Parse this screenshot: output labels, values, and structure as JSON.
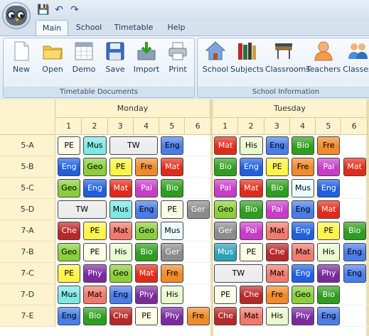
{
  "ribbon": {
    "tabs": [
      "Main",
      "School",
      "Timetable",
      "Help"
    ],
    "groups": {
      "documents": {
        "label": "Timetable Documents",
        "buttons": [
          "New",
          "Open",
          "Demo",
          "Save",
          "Import",
          "Print"
        ]
      },
      "school": {
        "label": "School Information",
        "buttons": [
          "School",
          "Subjects",
          "Classrooms",
          "Teachers",
          "Classes"
        ]
      }
    }
  },
  "timetable": {
    "days": [
      "Monday",
      "Tuesday"
    ],
    "periods": [
      "1",
      "2",
      "3",
      "4",
      "5",
      "6"
    ],
    "colors": {
      "PE": "#fdfdd8",
      "Mus": "#7be3e6",
      "TW": "#ececec",
      "Eng": "#1f5fe0",
      "Geo": "#8ccf3c",
      "Fre": "#f08a2a",
      "Mat": "#e02020",
      "Bio": "#2e9e1e",
      "Pai": "#c83cc8",
      "Ger": "#808080",
      "Che": "#b82828",
      "His": "#e6f7c2",
      "Phy": "#7a2a9e",
      "Mus7": "#2aa2b8",
      "MatLight": "#f07a6e",
      "MusLight": "#e9fdff",
      "PeTue": "#fdfdd8"
    },
    "rows": [
      {
        "label": "5-A",
        "mon": [
          {
            "s": "PE",
            "p": 1,
            "c": "#fdfde6"
          },
          {
            "s": "Mus",
            "p": 2,
            "c": "#7ee8e6"
          },
          {
            "s": "TW",
            "p": 3,
            "span": 2,
            "c": "#ececec"
          },
          {
            "s": "Eng",
            "p": 5,
            "c": "#4a7de8"
          }
        ],
        "tue": [
          {
            "s": "Mat",
            "p": 1,
            "c": "#e22a1a"
          },
          {
            "s": "His",
            "p": 2,
            "c": "#eafad0"
          },
          {
            "s": "Eng",
            "p": 3,
            "c": "#4a7de8"
          },
          {
            "s": "Bio",
            "p": 4,
            "c": "#2e9e1e"
          },
          {
            "s": "Fre",
            "p": 5,
            "c": "#f08a2a"
          }
        ]
      },
      {
        "label": "5-B",
        "mon": [
          {
            "s": "Eng",
            "p": 1,
            "c": "#1f5fe0"
          },
          {
            "s": "Geo",
            "p": 2,
            "c": "#8ccf3c"
          },
          {
            "s": "PE",
            "p": 3,
            "c": "#fff44a"
          },
          {
            "s": "Fre",
            "p": 4,
            "c": "#f08a2a"
          },
          {
            "s": "Mat",
            "p": 5,
            "c": "#e22a1a"
          }
        ],
        "tue": [
          {
            "s": "Bio",
            "p": 1,
            "c": "#2e9e1e"
          },
          {
            "s": "Eng",
            "p": 2,
            "c": "#1f5fe0"
          },
          {
            "s": "PE",
            "p": 3,
            "c": "#fff44a"
          },
          {
            "s": "Fre",
            "p": 4,
            "c": "#f08a2a"
          },
          {
            "s": "Pai",
            "p": 5,
            "c": "#c83cc8"
          },
          {
            "s": "Mat",
            "p": 6,
            "c": "#e22a1a"
          }
        ]
      },
      {
        "label": "5-C",
        "mon": [
          {
            "s": "Geo",
            "p": 1,
            "c": "#8ccf3c"
          },
          {
            "s": "Eng",
            "p": 2,
            "c": "#1f5fe0"
          },
          {
            "s": "Mat",
            "p": 3,
            "c": "#e22a1a"
          },
          {
            "s": "Pai",
            "p": 4,
            "c": "#c83cc8"
          },
          {
            "s": "Bio",
            "p": 5,
            "c": "#2e9e1e"
          }
        ],
        "tue": [
          {
            "s": "Pai",
            "p": 1,
            "c": "#c83cc8"
          },
          {
            "s": "Mat",
            "p": 2,
            "c": "#e22a1a"
          },
          {
            "s": "Bio",
            "p": 3,
            "c": "#2e9e1e"
          },
          {
            "s": "Mus",
            "p": 4,
            "c": "#e9fdff"
          },
          {
            "s": "Eng",
            "p": 5,
            "c": "#1f5fe0"
          }
        ]
      },
      {
        "label": "5-D",
        "mon": [
          {
            "s": "TW",
            "p": 1,
            "span": 2,
            "c": "#ececec"
          },
          {
            "s": "Mus",
            "p": 3,
            "c": "#7ee8e6"
          },
          {
            "s": "Eng",
            "p": 4,
            "c": "#4a7de8"
          },
          {
            "s": "PE",
            "p": 5,
            "c": "#fdfde6"
          },
          {
            "s": "Ger",
            "p": 6,
            "c": "#8c8c8c"
          }
        ],
        "tue": [
          {
            "s": "Geo",
            "p": 1,
            "c": "#8ccf3c"
          },
          {
            "s": "Bio",
            "p": 2,
            "c": "#2e9e1e"
          },
          {
            "s": "Pai",
            "p": 3,
            "c": "#c83cc8"
          },
          {
            "s": "Eng",
            "p": 4,
            "c": "#4a7de8"
          },
          {
            "s": "Mat",
            "p": 5,
            "c": "#e22a1a"
          }
        ]
      },
      {
        "label": "7-A",
        "mon": [
          {
            "s": "Che",
            "p": 1,
            "c": "#b82828"
          },
          {
            "s": "PE",
            "p": 2,
            "c": "#fff44a"
          },
          {
            "s": "Mat",
            "p": 3,
            "c": "#f07a6e"
          },
          {
            "s": "Geo",
            "p": 4,
            "c": "#8ccf3c"
          },
          {
            "s": "Mus",
            "p": 5,
            "c": "#e9fdff"
          }
        ],
        "tue": [
          {
            "s": "Ger",
            "p": 1,
            "c": "#8c8c8c"
          },
          {
            "s": "Pai",
            "p": 2,
            "c": "#c83cc8"
          },
          {
            "s": "Mat",
            "p": 3,
            "c": "#f07a6e"
          },
          {
            "s": "Eng",
            "p": 4,
            "c": "#1f5fe0"
          },
          {
            "s": "PE",
            "p": 5,
            "c": "#fff44a"
          },
          {
            "s": "Bio",
            "p": 6,
            "c": "#2e9e1e"
          }
        ]
      },
      {
        "label": "7-B",
        "mon": [
          {
            "s": "Geo",
            "p": 1,
            "c": "#8ccf3c"
          },
          {
            "s": "PE",
            "p": 2,
            "c": "#fdfde6"
          },
          {
            "s": "His",
            "p": 3,
            "c": "#eafad0"
          },
          {
            "s": "Bio",
            "p": 4,
            "c": "#2e9e1e"
          },
          {
            "s": "Ger",
            "p": 5,
            "c": "#8c8c8c"
          }
        ],
        "tue": [
          {
            "s": "Mus",
            "p": 1,
            "c": "#2aa2b8"
          },
          {
            "s": "PE",
            "p": 2,
            "c": "#fdfde6"
          },
          {
            "s": "Che",
            "p": 3,
            "c": "#b82828"
          },
          {
            "s": "Mat",
            "p": 4,
            "c": "#f07a6e"
          },
          {
            "s": "His",
            "p": 5,
            "c": "#eafad0"
          },
          {
            "s": "Eng",
            "p": 6,
            "c": "#4a7de8"
          }
        ]
      },
      {
        "label": "7-C",
        "mon": [
          {
            "s": "PE",
            "p": 1,
            "c": "#fff44a"
          },
          {
            "s": "Phy",
            "p": 2,
            "c": "#7a2a9e"
          },
          {
            "s": "Geo",
            "p": 3,
            "c": "#8ccf3c"
          },
          {
            "s": "Mat",
            "p": 4,
            "c": "#e22a1a"
          },
          {
            "s": "Fre",
            "p": 5,
            "c": "#f08a2a"
          }
        ],
        "tue": [
          {
            "s": "TW",
            "p": 1,
            "span": 2,
            "c": "#ececec"
          },
          {
            "s": "Mat",
            "p": 3,
            "c": "#f07a6e"
          },
          {
            "s": "Eng",
            "p": 4,
            "c": "#1f5fe0"
          },
          {
            "s": "Phy",
            "p": 5,
            "c": "#7a2a9e"
          },
          {
            "s": "Eng",
            "p": 6,
            "c": "#4a7de8"
          }
        ]
      },
      {
        "label": "7-D",
        "mon": [
          {
            "s": "Mus",
            "p": 1,
            "c": "#7ee8e6"
          },
          {
            "s": "Mat",
            "p": 2,
            "c": "#f07a6e"
          },
          {
            "s": "Eng",
            "p": 3,
            "c": "#4a7de8"
          },
          {
            "s": "Phy",
            "p": 4,
            "c": "#7a2a9e"
          },
          {
            "s": "His",
            "p": 5,
            "c": "#eafad0"
          }
        ],
        "tue": [
          {
            "s": "PE",
            "p": 1,
            "c": "#fdfde6"
          },
          {
            "s": "Che",
            "p": 2,
            "c": "#b82828"
          },
          {
            "s": "Fre",
            "p": 3,
            "c": "#f08a2a"
          },
          {
            "s": "Geo",
            "p": 4,
            "c": "#8ccf3c"
          },
          {
            "s": "Bio",
            "p": 5,
            "c": "#2e9e1e"
          }
        ]
      },
      {
        "label": "7-E",
        "mon": [
          {
            "s": "Eng",
            "p": 1,
            "c": "#4a7de8"
          },
          {
            "s": "Bio",
            "p": 2,
            "c": "#2e9e1e"
          },
          {
            "s": "Che",
            "p": 3,
            "c": "#b82828"
          },
          {
            "s": "PE",
            "p": 4,
            "c": "#fdfde6"
          },
          {
            "s": "Phy",
            "p": 5,
            "c": "#7a2a9e"
          },
          {
            "s": "Fre",
            "p": 6,
            "c": "#f08a2a"
          }
        ],
        "tue": [
          {
            "s": "Che",
            "p": 1,
            "c": "#b82828"
          },
          {
            "s": "Mat",
            "p": 2,
            "c": "#f07a6e"
          },
          {
            "s": "His",
            "p": 3,
            "c": "#eafad0"
          },
          {
            "s": "Phy",
            "p": 4,
            "c": "#7a2a9e"
          },
          {
            "s": "Eng",
            "p": 5,
            "c": "#4a7de8"
          }
        ]
      }
    ]
  }
}
